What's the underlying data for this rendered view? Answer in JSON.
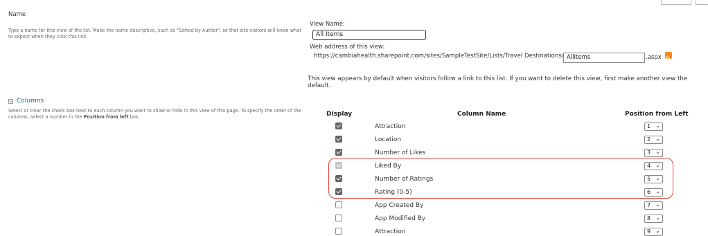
{
  "name_section": {
    "title": "Name",
    "description": "Type a name for this view of the list. Make the name descriptive, such as \"Sorted by Author\", so that site visitors will know what to expect when they click this link.",
    "view_name_label": "View Name:",
    "view_name_value": "All Items",
    "web_address_label": "Web address of this view:",
    "url_prefix": "https://cambiahealth.sharepoint.com/sites/SampleTestSite/Lists/Travel Destinations/",
    "url_value": "AllItems",
    "url_suffix": ".aspx",
    "default_note": "This view appears by default when visitors follow a link to this list. If you want to delete this view, first make another view the default."
  },
  "columns_section": {
    "title": "Columns",
    "description_part1": "Select or clear the check box next to each column you want to show or hide in this view of this page. To specify the order of the columns, select a number in the ",
    "description_bold": "Position from left",
    "description_part2": " box.",
    "headers": {
      "display": "Display",
      "column_name": "Column Name",
      "position": "Position from Left"
    },
    "rows": [
      {
        "name": "Attraction",
        "checked": true,
        "disabled": false,
        "position": "1"
      },
      {
        "name": "Location",
        "checked": true,
        "disabled": false,
        "position": "2"
      },
      {
        "name": "Number of Likes",
        "checked": true,
        "disabled": false,
        "position": "3"
      },
      {
        "name": "Liked By",
        "checked": true,
        "disabled": true,
        "position": "4"
      },
      {
        "name": "Number of Ratings",
        "checked": true,
        "disabled": false,
        "position": "5"
      },
      {
        "name": "Rating (0-5)",
        "checked": true,
        "disabled": false,
        "position": "6"
      },
      {
        "name": "App Created By",
        "checked": false,
        "disabled": false,
        "position": "7"
      },
      {
        "name": "App Modified By",
        "checked": false,
        "disabled": false,
        "position": "8"
      },
      {
        "name": "Attraction",
        "checked": false,
        "disabled": false,
        "position": "9"
      }
    ]
  },
  "icons": {
    "rss": "rss-feed-icon",
    "collapse": "collapse-minus-icon",
    "chevron": "chevron-down-icon"
  },
  "colors": {
    "highlight": "#e0403a",
    "rss": "#f58a1f",
    "link": "#1a6a8a"
  }
}
